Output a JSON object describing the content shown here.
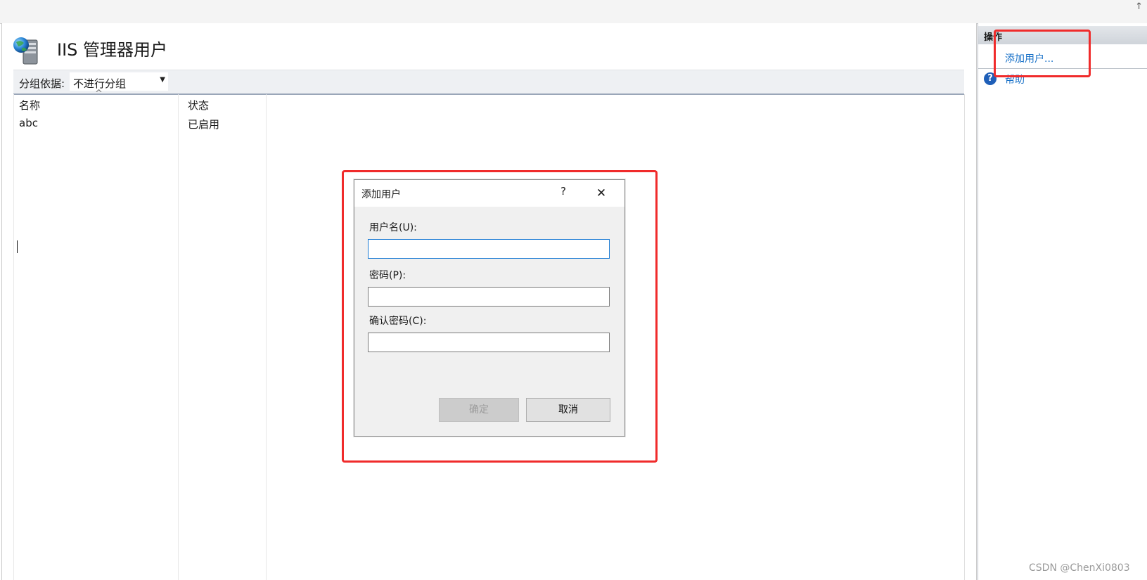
{
  "page": {
    "title": "IIS 管理器用户",
    "group_by_label": "分组依据:",
    "group_by_value": "不进行分组"
  },
  "columns": [
    "名称",
    "状态"
  ],
  "rows": [
    {
      "name": "abc",
      "status": "已启用"
    }
  ],
  "dialog": {
    "title": "添加用户",
    "help_glyph": "?",
    "close_glyph": "✕",
    "username_label": "用户名(U):",
    "username_value": "",
    "password_label": "密码(P):",
    "password_value": "",
    "confirm_label": "确认密码(C):",
    "confirm_value": "",
    "ok_label": "确定",
    "cancel_label": "取消"
  },
  "actions": {
    "title": "操作",
    "add_user": "添加用户...",
    "help": "帮助"
  },
  "watermark": "CSDN @ChenXi0803",
  "colors": {
    "annotation_red": "#f02b2b",
    "link_blue": "#1a72c8",
    "focus_blue": "#1a7ad4"
  }
}
